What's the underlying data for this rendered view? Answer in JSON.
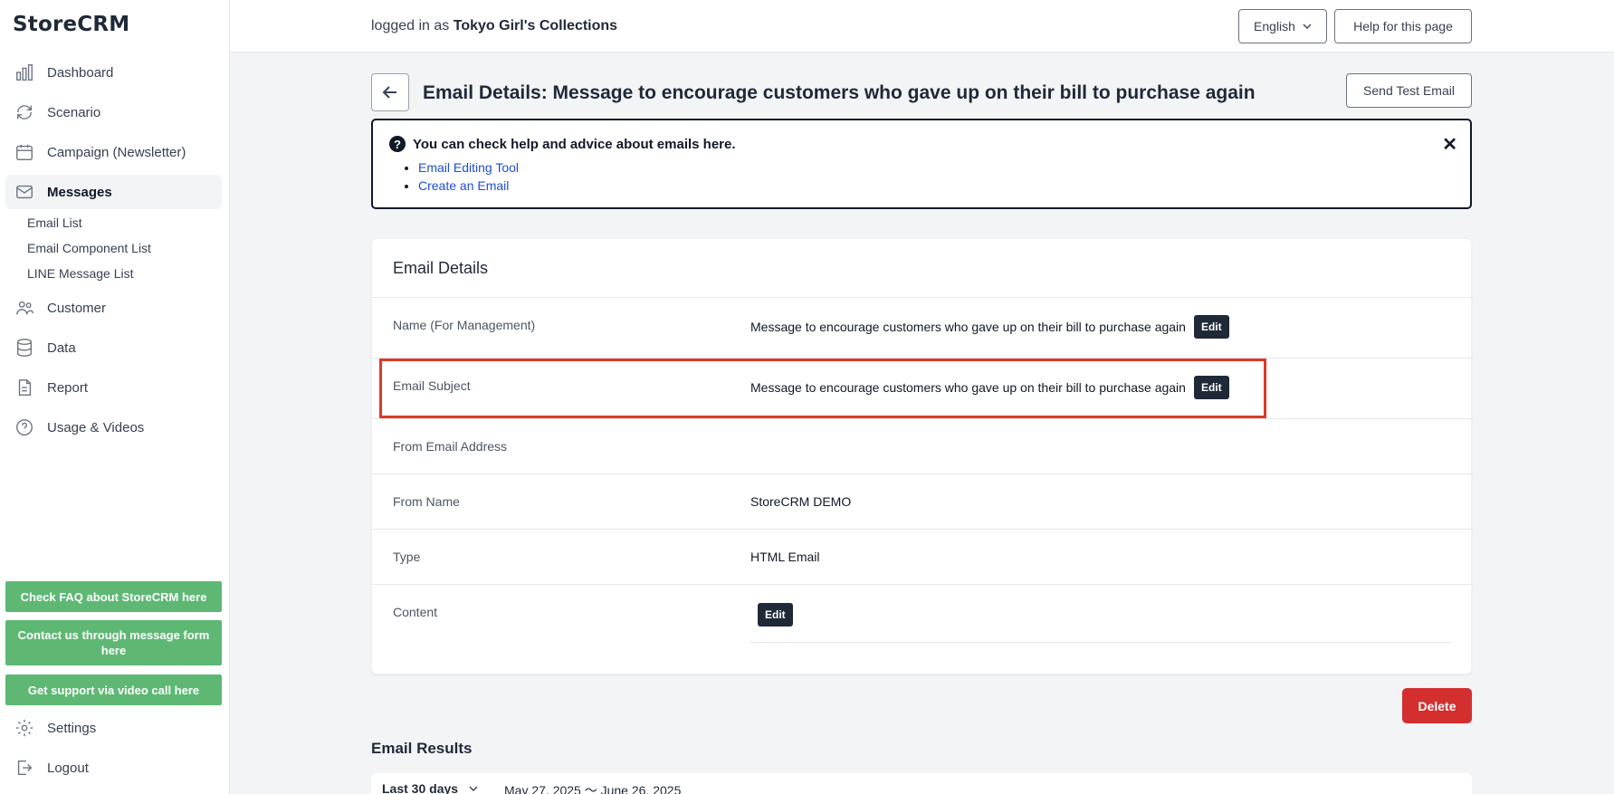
{
  "app": {
    "logo": "StoreCRM"
  },
  "sidebar": {
    "items": [
      {
        "label": "Dashboard",
        "icon": "bar-chart-icon"
      },
      {
        "label": "Scenario",
        "icon": "sync-icon"
      },
      {
        "label": "Campaign (Newsletter)",
        "icon": "calendar-icon"
      },
      {
        "label": "Messages",
        "icon": "envelope-icon"
      },
      {
        "label": "Customer",
        "icon": "users-icon"
      },
      {
        "label": "Data",
        "icon": "database-icon"
      },
      {
        "label": "Report",
        "icon": "document-icon"
      },
      {
        "label": "Usage & Videos",
        "icon": "question-circle-icon"
      }
    ],
    "sub_items": [
      "Email List",
      "Email Component List",
      "LINE Message List"
    ],
    "support_buttons": [
      "Check FAQ about StoreCRM here",
      "Contact us through message form here",
      "Get support via video call here"
    ],
    "settings": "Settings",
    "logout": "Logout"
  },
  "header": {
    "logged_prefix": "logged in as",
    "store_name": "Tokyo Girl's Collections",
    "language": "English",
    "help_button": "Help for this page"
  },
  "page": {
    "title": "Email Details: Message to encourage customers who gave up on their bill to purchase again",
    "send_test": "Send Test Email"
  },
  "help_box": {
    "title": "You can check help and advice about emails here.",
    "links": [
      "Email Editing Tool",
      "Create an Email"
    ],
    "close": "✕"
  },
  "details": {
    "title": "Email Details",
    "edit_label": "Edit",
    "rows": [
      {
        "label": "Name (For Management)",
        "value": "Message to encourage customers who gave up on their bill to purchase again"
      },
      {
        "label": "Email Subject",
        "value": "Message to encourage customers who gave up on their bill to purchase again"
      },
      {
        "label": "From Email Address",
        "value": ""
      },
      {
        "label": "From Name",
        "value": "StoreCRM DEMO"
      },
      {
        "label": "Type",
        "value": "HTML Email"
      },
      {
        "label": "Content",
        "value": ""
      }
    ]
  },
  "actions": {
    "delete": "Delete"
  },
  "results": {
    "title": "Email Results",
    "range": "Last 30 days",
    "dates": "May 27, 2025 〜 June 26, 2025"
  },
  "colors": {
    "green": "#5eb874",
    "danger": "#d32f2f",
    "highlight": "#dc3b26",
    "dark": "#1f2937"
  }
}
